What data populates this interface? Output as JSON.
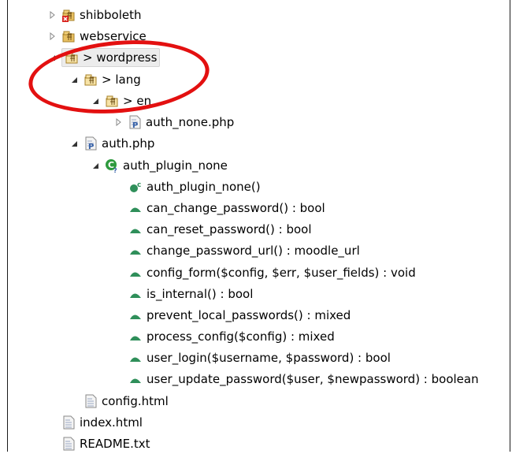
{
  "tree": {
    "shibboleth": "shibboleth",
    "webservice": "webservice",
    "wordpress": "> wordpress",
    "lang": "> lang",
    "en": "> en",
    "auth_none": "auth_none.php",
    "auth_php": "auth.php",
    "class_name": "auth_plugin_none",
    "methods": [
      "auth_plugin_none()",
      "can_change_password() : bool",
      "can_reset_password() : bool",
      "change_password_url() : moodle_url",
      "config_form($config, $err, $user_fields) : void",
      "is_internal() : bool",
      "prevent_local_passwords() : mixed",
      "process_config($config) : mixed",
      "user_login($username, $password) : bool",
      "user_update_password($user, $newpassword) : boolean"
    ],
    "config_html": "config.html",
    "index_html": "index.html",
    "readme": "README.txt"
  },
  "colors": {
    "annotation_circle": "#e31010",
    "method_icon": "#2f8f5a",
    "class_icon": "#2e9a3e"
  }
}
